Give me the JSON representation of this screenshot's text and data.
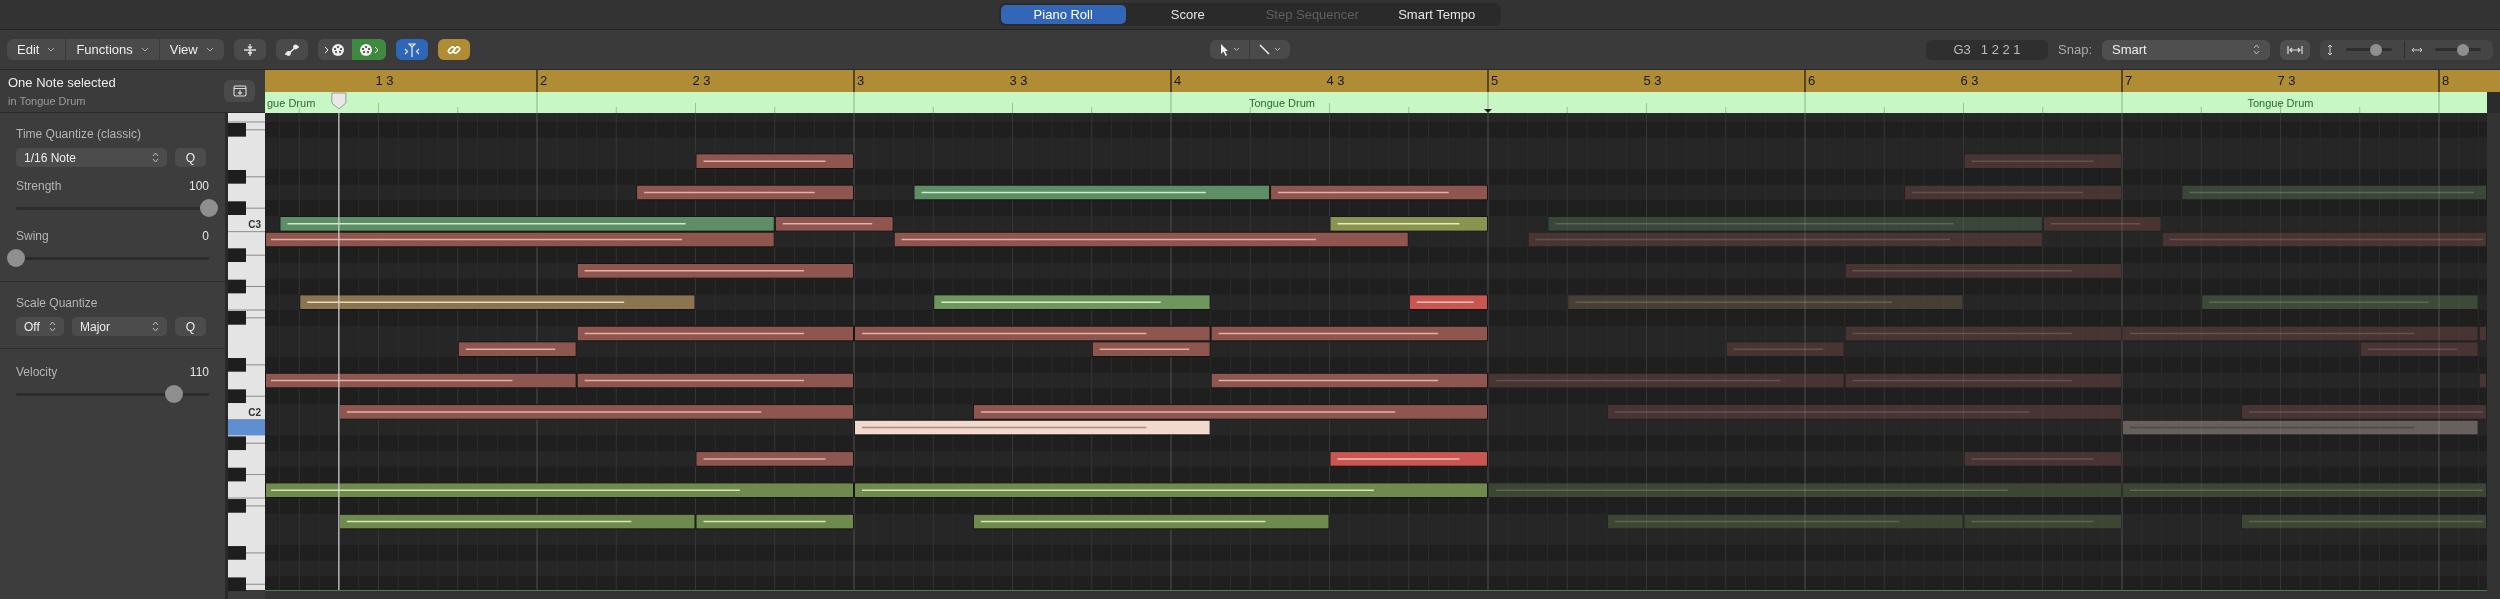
{
  "tabs": [
    {
      "label": "Piano Roll",
      "selected": true,
      "disabled": false
    },
    {
      "label": "Score",
      "selected": false,
      "disabled": false
    },
    {
      "label": "Step Sequencer",
      "selected": false,
      "disabled": true
    },
    {
      "label": "Smart Tempo",
      "selected": false,
      "disabled": false
    }
  ],
  "toolbar": {
    "menus": [
      "Edit",
      "Functions",
      "View"
    ],
    "toggles": [
      {
        "kind": "midi-in",
        "on": false
      },
      {
        "kind": "midi-out",
        "on": true
      },
      {
        "kind": "catch",
        "on": true
      },
      {
        "kind": "link",
        "on": true
      }
    ],
    "position_display": {
      "pitch": "G3",
      "position": "1 2 2 1"
    },
    "snap": {
      "label": "Snap:",
      "value": "Smart"
    },
    "vertical_zoom": {
      "level": 0.65
    },
    "horizontal_zoom": {
      "level": 0.6
    }
  },
  "inspector": {
    "title": "One Note selected",
    "subtitle": "in Tongue Drum",
    "time_quantize": {
      "heading": "Time Quantize (classic)",
      "value": "1/16 Note",
      "button": "Q",
      "strength": {
        "label": "Strength",
        "value": "100",
        "level": 1
      },
      "swing": {
        "label": "Swing",
        "value": "0",
        "level": 0
      }
    },
    "scale_quantize": {
      "heading": "Scale Quantize",
      "mode": "Off",
      "scale": "Major",
      "button": "Q"
    },
    "velocity": {
      "label": "Velocity",
      "value": "110",
      "level": 0.82
    }
  },
  "ruler": {
    "markers": [
      "1 3",
      "2",
      "2 3",
      "3",
      "3 3",
      "4",
      "4 3",
      "5",
      "5 3",
      "6",
      "6 3",
      "7",
      "7 3",
      "8"
    ]
  },
  "region": {
    "labels": [
      "gue Drum",
      "Tongue Drum",
      "Tongue Drum"
    ]
  },
  "keyboard": {
    "labels": [
      "C3",
      "C2"
    ]
  }
}
